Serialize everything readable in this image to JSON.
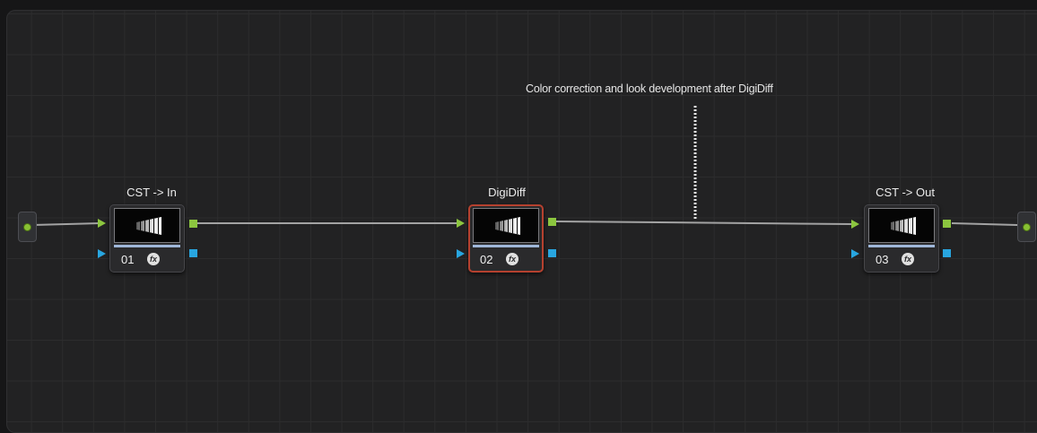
{
  "annotation": "Color correction and look development after DigiDiff",
  "input_node": {
    "name": "source-input-node"
  },
  "output_node": {
    "name": "output-node"
  },
  "nodes": [
    {
      "label": "CST -> In",
      "number": "01",
      "fx": "fx",
      "selected": false
    },
    {
      "label": "DigiDiff",
      "number": "02",
      "fx": "fx",
      "selected": true
    },
    {
      "label": "CST -> Out",
      "number": "03",
      "fx": "fx",
      "selected": false
    }
  ],
  "colors": {
    "rgb_port": "#8cc63f",
    "alpha_port": "#28a6e0",
    "selected_outline": "#b5412f",
    "link": "#a3a3a3"
  }
}
